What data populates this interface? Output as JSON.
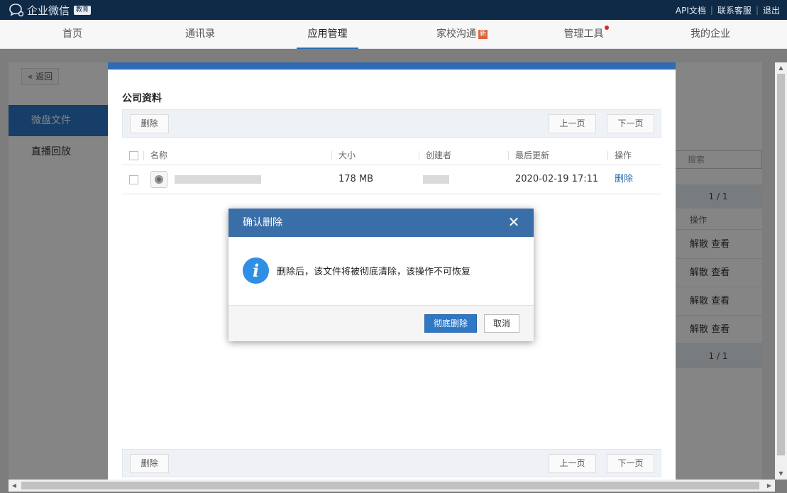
{
  "app": {
    "title": "企业微信",
    "badge": "教育"
  },
  "toplinks": [
    "API文档",
    "联系客服",
    "退出"
  ],
  "nav": [
    {
      "label": "首页"
    },
    {
      "label": "通讯录"
    },
    {
      "label": "应用管理"
    },
    {
      "label": "家校沟通",
      "badge": "新"
    },
    {
      "label": "管理工具"
    },
    {
      "label": "我的企业"
    }
  ],
  "page": {
    "back_label": "返回",
    "sidebar": [
      {
        "label": "微盘文件"
      },
      {
        "label": "直播回放"
      }
    ],
    "search_placeholder": "搜索",
    "pager": "1 / 1",
    "action_header": "操作",
    "row_actions": [
      {
        "a": "解散",
        "b": "查看"
      },
      {
        "a": "解散",
        "b": "查看"
      },
      {
        "a": "解散",
        "b": "查看"
      },
      {
        "a": "解散",
        "b": "查看"
      }
    ]
  },
  "file_dialog": {
    "title": "公司资料",
    "delete_label": "删除",
    "prev_label": "上一页",
    "next_label": "下一页",
    "columns": {
      "name": "名称",
      "size": "大小",
      "creator": "创建者",
      "updated": "最后更新",
      "action": "操作"
    },
    "rows": [
      {
        "size": "178 MB",
        "updated": "2020-02-19 17:11",
        "action": "删除"
      }
    ]
  },
  "confirm": {
    "title": "确认删除",
    "message": "删除后，该文件将被彻底清除，该操作不可恢复",
    "confirm_label": "彻底删除",
    "cancel_label": "取消"
  }
}
